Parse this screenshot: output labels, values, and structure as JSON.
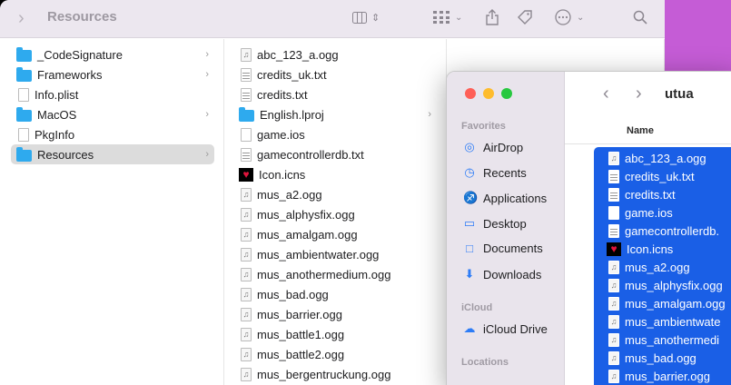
{
  "back_window": {
    "title": "Resources",
    "sidebar_items": [
      {
        "label": "_CodeSignature",
        "icon": "folder-icon",
        "has_children": true,
        "selected": false
      },
      {
        "label": "Frameworks",
        "icon": "folder-icon",
        "has_children": true,
        "selected": false
      },
      {
        "label": "Info.plist",
        "icon": "doc-icon",
        "has_children": false,
        "selected": false
      },
      {
        "label": "MacOS",
        "icon": "folder-icon",
        "has_children": true,
        "selected": false
      },
      {
        "label": "PkgInfo",
        "icon": "doc-icon",
        "has_children": false,
        "selected": false
      },
      {
        "label": "Resources",
        "icon": "folder-icon",
        "has_children": true,
        "selected": true
      }
    ],
    "files": [
      {
        "label": "abc_123_a.ogg",
        "icon": "audio-icon"
      },
      {
        "label": "credits_uk.txt",
        "icon": "txt-icon"
      },
      {
        "label": "credits.txt",
        "icon": "txt-icon"
      },
      {
        "label": "English.lproj",
        "icon": "folder-icon",
        "has_children": true
      },
      {
        "label": "game.ios",
        "icon": "doc-icon"
      },
      {
        "label": "gamecontrollerdb.txt",
        "icon": "txt-icon"
      },
      {
        "label": "Icon.icns",
        "icon": "heart-icon"
      },
      {
        "label": "mus_a2.ogg",
        "icon": "audio-icon"
      },
      {
        "label": "mus_alphysfix.ogg",
        "icon": "audio-icon"
      },
      {
        "label": "mus_amalgam.ogg",
        "icon": "audio-icon"
      },
      {
        "label": "mus_ambientwater.ogg",
        "icon": "audio-icon"
      },
      {
        "label": "mus_anothermedium.ogg",
        "icon": "audio-icon"
      },
      {
        "label": "mus_bad.ogg",
        "icon": "audio-icon"
      },
      {
        "label": "mus_barrier.ogg",
        "icon": "audio-icon"
      },
      {
        "label": "mus_battle1.ogg",
        "icon": "audio-icon"
      },
      {
        "label": "mus_battle2.ogg",
        "icon": "audio-icon"
      },
      {
        "label": "mus_bergentruckung.ogg",
        "icon": "audio-icon"
      }
    ]
  },
  "front_window": {
    "title": "utua",
    "column_header": "Name",
    "sidebar": {
      "favorites_label": "Favorites",
      "favorites": [
        {
          "label": "AirDrop",
          "icon": "airdrop-icon"
        },
        {
          "label": "Recents",
          "icon": "clock-icon"
        },
        {
          "label": "Applications",
          "icon": "applications-icon"
        },
        {
          "label": "Desktop",
          "icon": "desktop-icon"
        },
        {
          "label": "Documents",
          "icon": "document-icon"
        },
        {
          "label": "Downloads",
          "icon": "download-icon"
        }
      ],
      "icloud_label": "iCloud",
      "icloud": [
        {
          "label": "iCloud Drive",
          "icon": "cloud-icon"
        }
      ],
      "locations_label": "Locations"
    },
    "files": [
      {
        "label": "abc_123_a.ogg",
        "icon": "audio-icon"
      },
      {
        "label": "credits_uk.txt",
        "icon": "txt-icon"
      },
      {
        "label": "credits.txt",
        "icon": "txt-icon"
      },
      {
        "label": "game.ios",
        "icon": "doc-icon"
      },
      {
        "label": "gamecontrollerdb.",
        "icon": "txt-icon"
      },
      {
        "label": "Icon.icns",
        "icon": "heart-icon"
      },
      {
        "label": "mus_a2.ogg",
        "icon": "audio-icon"
      },
      {
        "label": "mus_alphysfix.ogg",
        "icon": "audio-icon"
      },
      {
        "label": "mus_amalgam.ogg",
        "icon": "audio-icon"
      },
      {
        "label": "mus_ambientwate",
        "icon": "audio-icon"
      },
      {
        "label": "mus_anothermedi",
        "icon": "audio-icon"
      },
      {
        "label": "mus_bad.ogg",
        "icon": "audio-icon"
      },
      {
        "label": "mus_barrier.ogg",
        "icon": "audio-icon"
      }
    ]
  },
  "colors": {
    "selection": "#1a5fe6",
    "folder": "#2eaaee",
    "accent_icon": "#2d7cf6",
    "desktop": "#c55cd6"
  }
}
